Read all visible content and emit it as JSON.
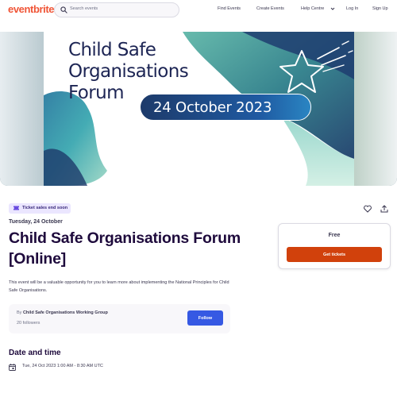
{
  "header": {
    "logo": "eventbrite",
    "search_placeholder": "Search events",
    "nav": {
      "find_events": "Find Events",
      "create_events": "Create Events",
      "help_centre": "Help Centre",
      "log_in": "Log In",
      "sign_up": "Sign Up"
    }
  },
  "hero": {
    "title_line1": "Child Safe",
    "title_line2": "Organisations",
    "title_line3": "Forum",
    "date_pill": "24 October 2023"
  },
  "event": {
    "badge": "Ticket sales end soon",
    "date_line": "Tuesday, 24 October",
    "title": "Child Safe Organisations Forum [Online]",
    "summary": "This event will be a valuable opportunity for you to learn more about implementing the National Principles for Child Safe Organisations.",
    "organizer": {
      "by": "By",
      "name": "Child Safe Organisations Working Group",
      "followers": "20 followers",
      "follow_label": "Follow"
    },
    "date_time": {
      "heading": "Date and time",
      "value": "Tue, 24 Oct 2023 1:00 AM - 8:30 AM UTC"
    }
  },
  "ticket": {
    "price": "Free",
    "cta_label": "Get tickets"
  },
  "icons": [
    "search-icon",
    "chevron-down-icon",
    "ticket-icon",
    "heart-icon",
    "share-icon",
    "calendar-icon",
    "star-icon"
  ],
  "colors": {
    "brand": "#f05537",
    "primary_text": "#1e0a3c",
    "follow_button": "#3659e3",
    "cta_button": "#d1410c",
    "badge_bg": "#ebe6ff",
    "date_pill": "#1f5aa2"
  }
}
